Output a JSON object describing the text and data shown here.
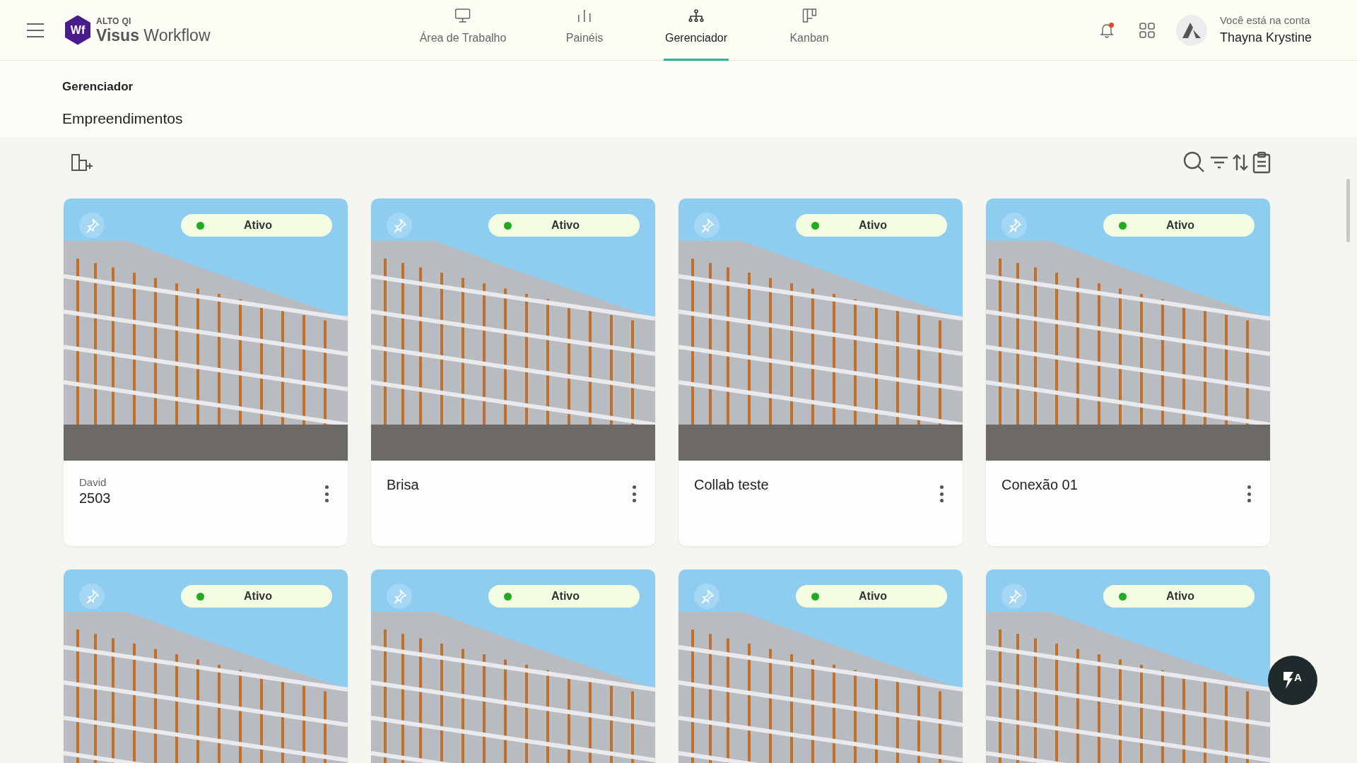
{
  "header": {
    "logo_mark": "Wf",
    "brand_top": "ALTO QI",
    "brand_bold": "Visus",
    "brand_light": "Workflow",
    "tabs": [
      {
        "label": "Área de Trabalho",
        "selected": false
      },
      {
        "label": "Painéis",
        "selected": false
      },
      {
        "label": "Gerenciador",
        "selected": true
      },
      {
        "label": "Kanban",
        "selected": false
      }
    ],
    "notification_unread": true,
    "account_caption": "Você está na conta",
    "account_name": "Thayna Krystine"
  },
  "breadcrumb": "Gerenciador",
  "page_title": "Empreendimentos",
  "cards": [
    {
      "status": "Ativo",
      "color": "#22aa22",
      "owner": "David",
      "title": "2503"
    },
    {
      "status": "Ativo",
      "color": "#22aa22",
      "title": "Brisa"
    },
    {
      "status": "Ativo",
      "color": "#22aa22",
      "title": "Collab teste"
    },
    {
      "status": "Ativo",
      "color": "#22aa22",
      "title": "Conexão 01"
    },
    {
      "status": "Ativo",
      "color": "#22aa22"
    },
    {
      "status": "Ativo",
      "color": "#22aa22"
    },
    {
      "status": "Ativo",
      "color": "#22aa22"
    },
    {
      "status": "Ativo",
      "color": "#22aa22"
    }
  ],
  "fab_label": "A"
}
